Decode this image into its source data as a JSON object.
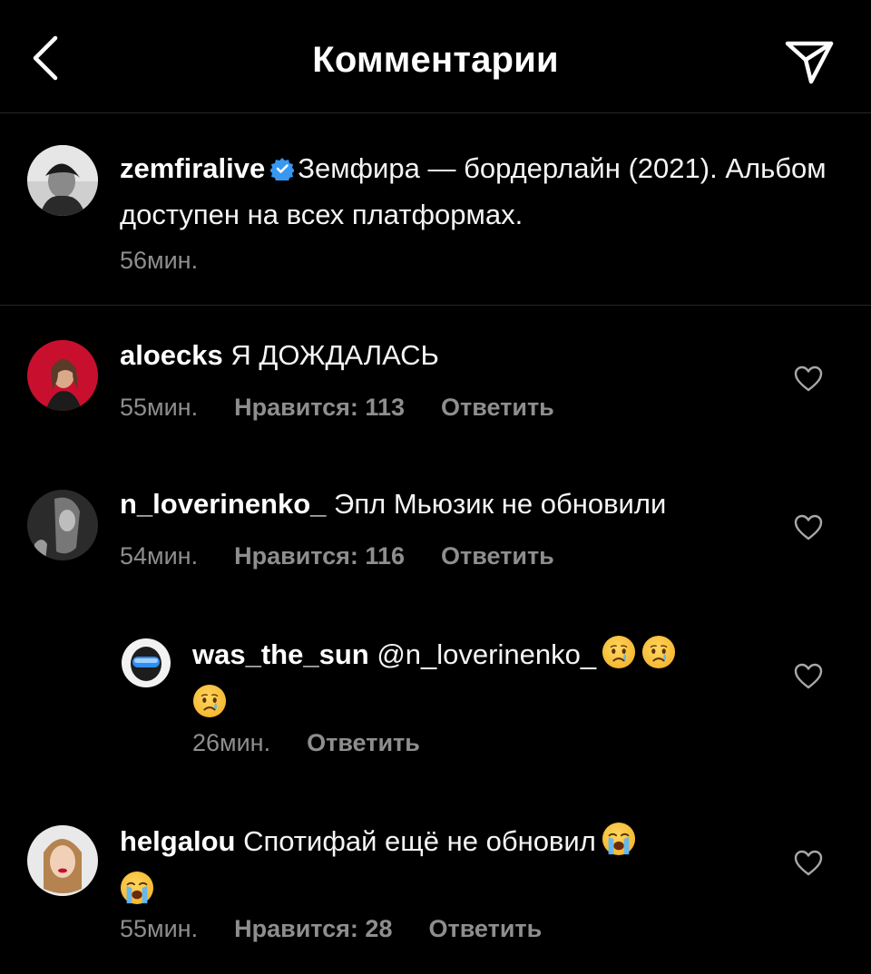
{
  "header": {
    "title": "Комментарии",
    "back_icon": "chevron-left-icon",
    "share_icon": "paper-plane-icon"
  },
  "caption": {
    "username": "zemfiralive",
    "verified": true,
    "text": "Земфира — бордерлайн (2021). Альбом доступен на всех платформах.",
    "time": "56мин."
  },
  "comments": [
    {
      "username": "aloecks",
      "text": "Я ДОЖДАЛАСЬ",
      "time": "55мин.",
      "likes": "Нравится: 113",
      "reply": "Ответить"
    },
    {
      "username": "n_loverinenko_",
      "text": "Эпл Мьюзик не обновили",
      "time": "54мин.",
      "likes": "Нравится: 116",
      "reply": "Ответить"
    },
    {
      "username": "was_the_sun",
      "mention": "@n_loverinenko_",
      "emojis": [
        "crying-face",
        "crying-face",
        "crying-face"
      ],
      "time": "26мин.",
      "reply": "Ответить"
    },
    {
      "username": "helgalou",
      "text": "Спотифай ещё не обновил",
      "emojis": [
        "loudly-crying-face",
        "loudly-crying-face"
      ],
      "time": "55мин.",
      "likes": "Нравится: 28",
      "reply": "Ответить"
    }
  ],
  "colors": {
    "background": "#000000",
    "secondary_text": "#8e8e8e",
    "verified_blue": "#3897f0",
    "divider": "#262626"
  }
}
